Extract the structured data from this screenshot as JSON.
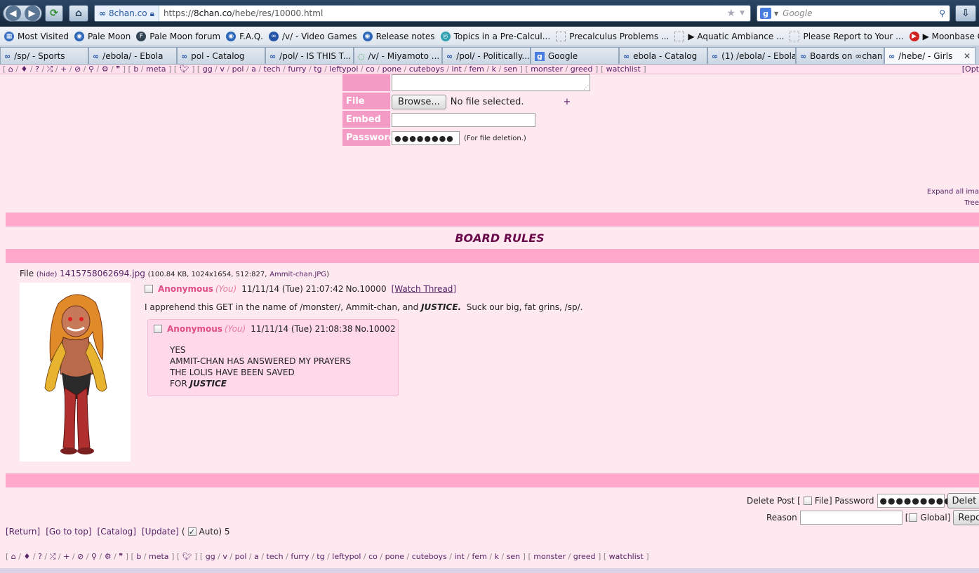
{
  "browser": {
    "url_site": "8chan.co",
    "url_prefix": "https://",
    "url_host": "8chan.co",
    "url_path": "/hebe/res/10000.html",
    "search_placeholder": "Google",
    "bookmarks": [
      {
        "label": "Most Visited",
        "icon": "bookmark-icon",
        "color": "#3a6fc4"
      },
      {
        "label": "Pale Moon",
        "icon": "globe-icon",
        "color": "#2d66b8"
      },
      {
        "label": "Pale Moon forum",
        "icon": "forum-icon",
        "color": "#334455"
      },
      {
        "label": "F.A.Q.",
        "icon": "globe-icon",
        "color": "#2d66b8"
      },
      {
        "label": "/v/ - Video Games",
        "icon": "infinity-icon",
        "color": "#2553a8"
      },
      {
        "label": "Release notes",
        "icon": "globe-icon",
        "color": "#2d66b8"
      },
      {
        "label": "Topics in a Pre-Calcul...",
        "icon": "site-icon",
        "color": "#33a0b0"
      },
      {
        "label": "Precalculus Problems ...",
        "icon": "blank-page-icon",
        "color": "#bbbbbb"
      },
      {
        "label": "▶ Aquatic Ambiance ...",
        "icon": "blank-page-icon",
        "color": "#bbbbbb"
      },
      {
        "label": "Please Report to Your ...",
        "icon": "blank-page-icon",
        "color": "#bbbbbb"
      },
      {
        "label": "▶ Moonbase Oddity -...",
        "icon": "youtube-icon",
        "color": "#d02020"
      }
    ],
    "tabs": [
      {
        "label": "/sp/ - Sports"
      },
      {
        "label": "/ebola/ - Ebola"
      },
      {
        "label": "pol - Catalog"
      },
      {
        "label": "/pol/ - IS THIS T..."
      },
      {
        "label": "/v/ - Miyamoto ..."
      },
      {
        "label": "/pol/ - Politically..."
      },
      {
        "label": "Google"
      },
      {
        "label": "ebola - Catalog"
      },
      {
        "label": "(1) /ebola/ - Ebola"
      },
      {
        "label": "Boards on ∞chan"
      },
      {
        "label": "/hebe/ - Girls",
        "active": true
      }
    ],
    "tab_close": "✕"
  },
  "boardlist": {
    "open": "[",
    "close": "]",
    "icons": [
      "home-icon",
      "tags-icon",
      "help-icon",
      "random-icon",
      "create-icon",
      "blocked-icon",
      "search-icon",
      "settings-icon",
      "quote-icon"
    ],
    "group1": [
      "b",
      "meta"
    ],
    "twitter": "twitter-icon",
    "group2": [
      "gg",
      "v",
      "pol",
      "a",
      "tech",
      "furry",
      "tg",
      "leftypol",
      "co",
      "pone",
      "cuteboys",
      "int",
      "fem",
      "k",
      "sen"
    ],
    "group3": [
      "monster",
      "greed"
    ],
    "group4": [
      "watchlist"
    ],
    "options": "[Opt"
  },
  "postform": {
    "file_label": "File",
    "browse_label": "Browse...",
    "no_file": "No file selected.",
    "plus": "+",
    "embed_label": "Embed",
    "password_label": "Password",
    "password_value": "●●●●●●●●",
    "password_note": "(For file deletion.)"
  },
  "page": {
    "expand_all": "Expand all ima",
    "tree": "Tree",
    "board_rules": "BOARD RULES"
  },
  "op": {
    "file_label": "File",
    "hide": "(hide)",
    "filename": "1415758062694.jpg",
    "file_meta": "(100.84 KB, 1024x1654, 512:827,",
    "orig_name": "Ammit-chan.JPG",
    "file_meta_close": ")",
    "name": "Anonymous",
    "you": "(You)",
    "date": "11/11/14 (Tue) 21:07:42",
    "no": "No.10000",
    "watch": "[Watch Thread]",
    "body_pre": "I apprehend this GET in the name of /monster/, Ammit-chan, and ",
    "body_bold": "JUSTICE.",
    "body_post": "  Suck our big, fat grins, /sp/."
  },
  "reply": {
    "name": "Anonymous",
    "you": "(You)",
    "date": "11/11/14 (Tue) 21:08:38",
    "no": "No.10002",
    "lines": [
      "YES",
      "AMMIT-CHAN HAS ANSWERED MY PRAYERS",
      "THE LOLIS HAVE BEEN SAVED"
    ],
    "last_pre": "FOR ",
    "last_bold": "JUSTICE"
  },
  "delete": {
    "label": "Delete Post [",
    "file": "File] Password",
    "password_value": "●●●●●●●●●",
    "delete_btn": "Delet",
    "reason_label": "Reason",
    "global": "Global]",
    "global_open": "[",
    "report_btn": "Repo"
  },
  "threadlinks": {
    "return": "[Return]",
    "top": "[Go to top]",
    "catalog": "[Catalog]",
    "update": "[Update]",
    "auto_open": "(",
    "auto": "Auto) 5"
  }
}
